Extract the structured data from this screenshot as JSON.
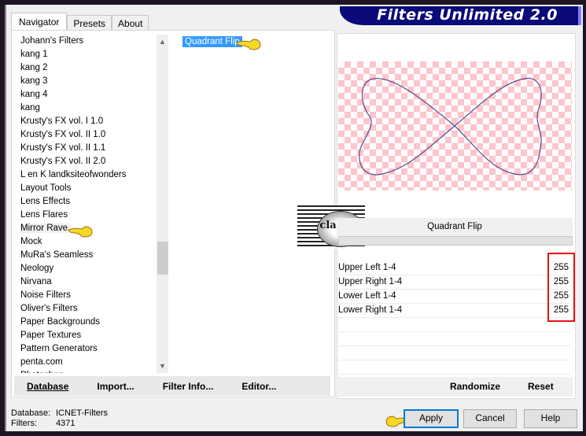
{
  "app": {
    "title": "Filters Unlimited 2.0"
  },
  "tabs": [
    {
      "label": "Navigator",
      "active": true
    },
    {
      "label": "Presets",
      "active": false
    },
    {
      "label": "About",
      "active": false
    }
  ],
  "categories": {
    "items": [
      "Johann's Filters",
      "kang 1",
      "kang 2",
      "kang 3",
      "kang 4",
      "kang",
      "Krusty's FX vol. I 1.0",
      "Krusty's FX vol. II 1.0",
      "Krusty's FX vol. II 1.1",
      "Krusty's FX vol. II 2.0",
      "L en K landksiteofwonders",
      "Layout Tools",
      "Lens Effects",
      "Lens Flares",
      "Mirror Rave",
      "Mock",
      "MuRa's Seamless",
      "Neology",
      "Nirvana",
      "Noise Filters",
      "Oliver's Filters",
      "Paper Backgrounds",
      "Paper Textures",
      "Pattern Generators",
      "penta.com",
      "Photoshop..."
    ],
    "selected": "Mirror Rave"
  },
  "filters": {
    "selected": "Quadrant Flip"
  },
  "left_buttons": {
    "database": "Database",
    "import": "Import...",
    "filter_info": "Filter Info...",
    "editor": "Editor..."
  },
  "status": {
    "database_label": "Database:",
    "database_value": "ICNET-Filters",
    "filters_label": "Filters:",
    "filters_value": "4371"
  },
  "preview": {
    "filter_name": "Quadrant Flip",
    "watermark": "claudia"
  },
  "parameters": [
    {
      "label": "Upper Left 1-4",
      "value": "255"
    },
    {
      "label": "Upper Right 1-4",
      "value": "255"
    },
    {
      "label": "Lower Left 1-4",
      "value": "255"
    },
    {
      "label": "Lower Right 1-4",
      "value": "255"
    }
  ],
  "right_buttons": {
    "randomize": "Randomize",
    "reset": "Reset"
  },
  "dialog_buttons": {
    "apply": "Apply",
    "cancel": "Cancel",
    "help": "Help"
  },
  "colors": {
    "banner": "#0a0a78",
    "selection": "#3399ff",
    "highlight_box": "#e81010",
    "checker": "#fcc6cc"
  }
}
